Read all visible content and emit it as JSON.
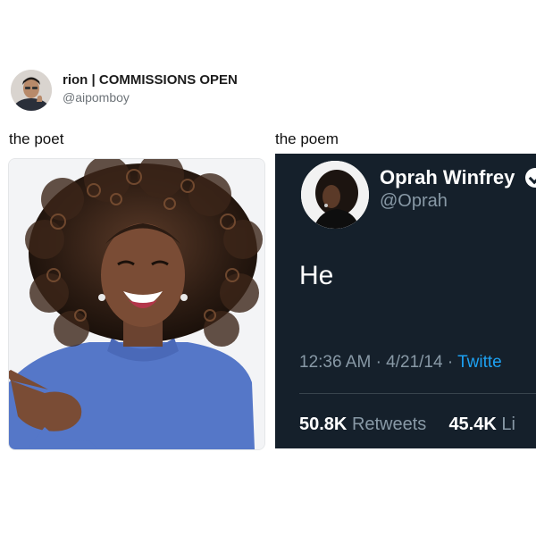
{
  "post": {
    "display_name": "rion | COMMISSIONS OPEN",
    "handle": "@aipomboy"
  },
  "left_caption": "the poet",
  "right_caption": "the poem",
  "embedded_tweet": {
    "name": "Oprah Winfrey",
    "handle": "@Oprah",
    "text": "He",
    "time": "12:36 AM",
    "date": "4/21/14",
    "source": "Twitte",
    "retweets_count": "50.8K",
    "retweets_label": "Retweets",
    "likes_count": "45.4K",
    "likes_label": "Li"
  }
}
